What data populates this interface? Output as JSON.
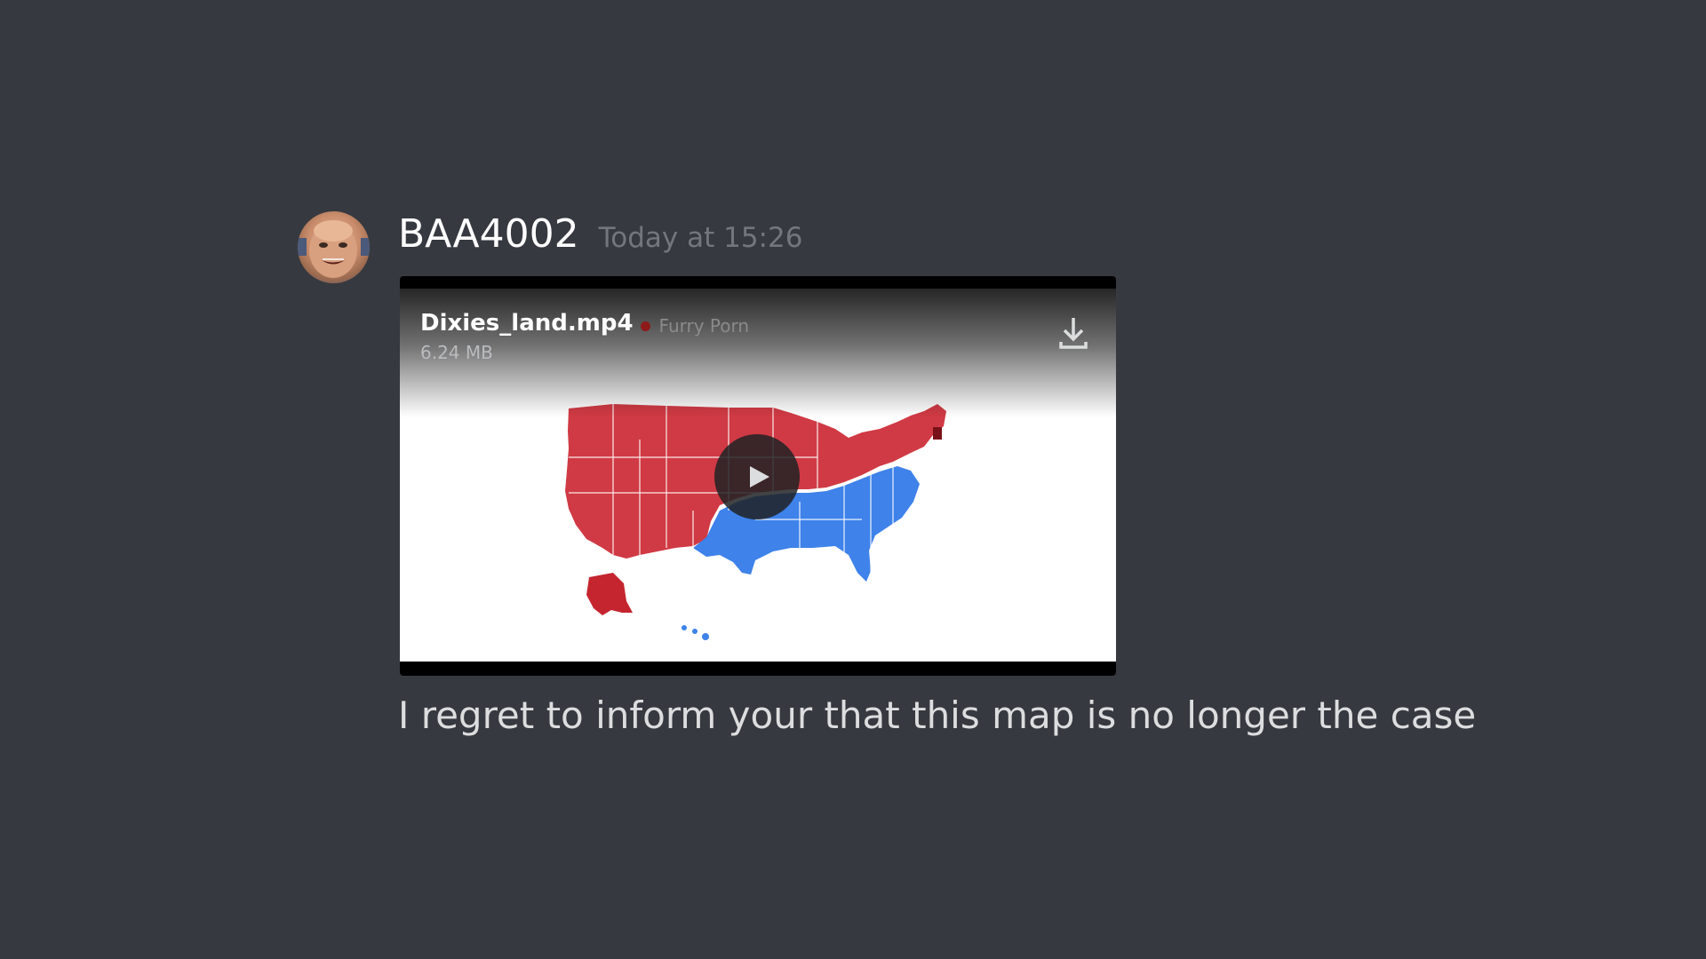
{
  "message": {
    "author": {
      "username": "BAA4002",
      "avatar_icon": "user-avatar-icon"
    },
    "timestamp": "Today at 15:26",
    "attachment": {
      "filename": "Dixies_land.mp4",
      "tag_text": "Furry Porn",
      "tag_color": "#8e1a1a",
      "filesize": "6.24 MB",
      "download_icon": "download-icon",
      "play_icon": "play-icon"
    },
    "text": "I regret to inform your that this map is no longer the case"
  },
  "colors": {
    "background": "#36393f",
    "username": "#ffffff",
    "timestamp": "#72767d",
    "message_text": "#dcddde",
    "map_red": "#d03a44",
    "map_blue": "#3e82ea"
  }
}
